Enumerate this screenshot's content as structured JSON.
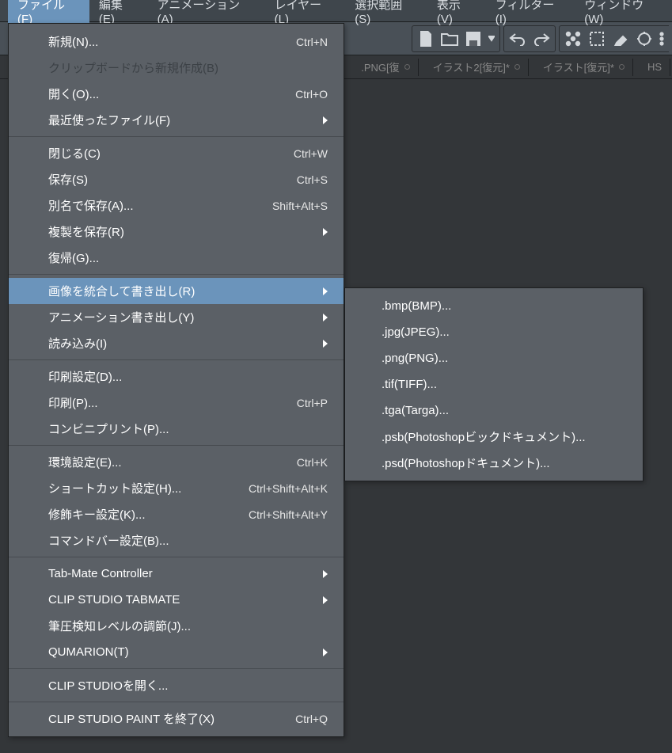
{
  "menubar": {
    "items": [
      "ファイル(F)",
      "編集(E)",
      "アニメーション(A)",
      "レイヤー(L)",
      "選択範囲(S)",
      "表示(V)",
      "フィルター(I)",
      "ウィンドウ(W)"
    ],
    "active_index": 0
  },
  "tabs": [
    {
      "label": ".PNG[復"
    },
    {
      "label": "イラスト2[復元]*"
    },
    {
      "label": "イラスト[復元]*"
    },
    {
      "label": "HS"
    }
  ],
  "file_menu": {
    "groups": [
      [
        {
          "label": "新規(N)...",
          "shortcut": "Ctrl+N"
        },
        {
          "label": "クリップボードから新規作成(B)",
          "disabled": true
        },
        {
          "label": "開く(O)...",
          "shortcut": "Ctrl+O"
        },
        {
          "label": "最近使ったファイル(F)",
          "submenu": true
        }
      ],
      [
        {
          "label": "閉じる(C)",
          "shortcut": "Ctrl+W"
        },
        {
          "label": "保存(S)",
          "shortcut": "Ctrl+S"
        },
        {
          "label": "別名で保存(A)...",
          "shortcut": "Shift+Alt+S"
        },
        {
          "label": "複製を保存(R)",
          "submenu": true
        },
        {
          "label": "復帰(G)..."
        }
      ],
      [
        {
          "label": "画像を統合して書き出し(R)",
          "submenu": true,
          "highlighted": true
        },
        {
          "label": "アニメーション書き出し(Y)",
          "submenu": true
        },
        {
          "label": "読み込み(I)",
          "submenu": true
        }
      ],
      [
        {
          "label": "印刷設定(D)..."
        },
        {
          "label": "印刷(P)...",
          "shortcut": "Ctrl+P"
        },
        {
          "label": "コンビニプリント(P)..."
        }
      ],
      [
        {
          "label": "環境設定(E)...",
          "shortcut": "Ctrl+K"
        },
        {
          "label": "ショートカット設定(H)...",
          "shortcut": "Ctrl+Shift+Alt+K"
        },
        {
          "label": "修飾キー設定(K)...",
          "shortcut": "Ctrl+Shift+Alt+Y"
        },
        {
          "label": "コマンドバー設定(B)..."
        }
      ],
      [
        {
          "label": "Tab-Mate Controller",
          "submenu": true
        },
        {
          "label": "CLIP STUDIO TABMATE",
          "submenu": true
        },
        {
          "label": "筆圧検知レベルの調節(J)..."
        },
        {
          "label": "QUMARION(T)",
          "submenu": true
        }
      ],
      [
        {
          "label": "CLIP STUDIOを開く..."
        }
      ],
      [
        {
          "label": "CLIP STUDIO PAINT を終了(X)",
          "shortcut": "Ctrl+Q"
        }
      ]
    ]
  },
  "export_submenu": {
    "items": [
      ".bmp(BMP)...",
      ".jpg(JPEG)...",
      ".png(PNG)...",
      ".tif(TIFF)...",
      ".tga(Targa)...",
      ".psb(Photoshopビックドキュメント)...",
      ".psd(Photoshopドキュメント)..."
    ]
  },
  "toolbar": {
    "icons": [
      "new-icon",
      "open-icon",
      "save-icon",
      "toggle-arrow",
      "undo-icon",
      "redo-icon",
      "nodes-icon",
      "selection-icon",
      "eraser-icon",
      "transform-icon",
      "more-icon"
    ]
  }
}
